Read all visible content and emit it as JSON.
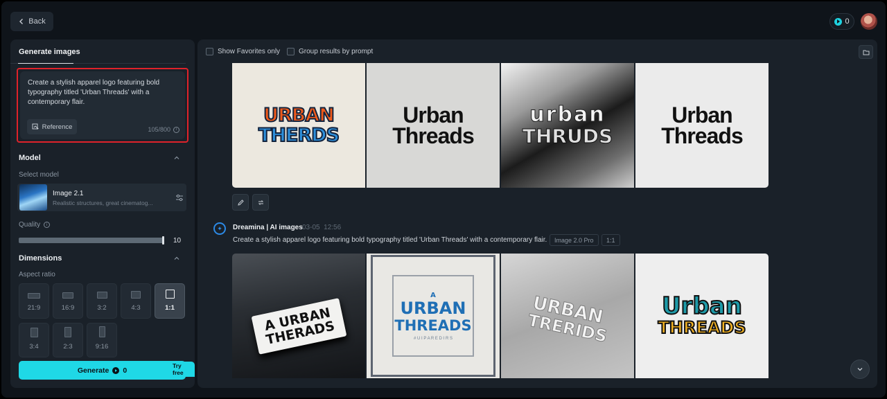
{
  "topbar": {
    "back_label": "Back",
    "credits": "0"
  },
  "left": {
    "tab": "Generate images",
    "prompt": "Create a stylish apparel logo featuring bold typography titled 'Urban Threads' with a contemporary flair.",
    "reference_label": "Reference",
    "char_count": "105/800",
    "model_heading": "Model",
    "select_model_label": "Select model",
    "model_name": "Image 2.1",
    "model_desc": "Realistic structures, great cinematog...",
    "quality_label": "Quality",
    "quality_value": "10",
    "dimensions_heading": "Dimensions",
    "aspect_ratio_label": "Aspect ratio",
    "ratios": [
      "21:9",
      "16:9",
      "3:2",
      "4:3",
      "1:1",
      "3:4",
      "2:3",
      "9:16"
    ],
    "selected_ratio": "1:1",
    "generate_label": "Generate",
    "generate_cost": "0",
    "try_free": "Try free"
  },
  "right": {
    "show_favorites": "Show Favorites only",
    "group_by_prompt": "Group results by prompt",
    "row1": [
      {
        "line1": "URBAN",
        "line2": "THERDS"
      },
      {
        "line1": "Urban",
        "line2": "Threads"
      },
      {
        "line1": "urban",
        "line2": "THRUDS"
      },
      {
        "line1": "Urban",
        "line2": "Threads"
      }
    ],
    "author": "Dreamina | AI images",
    "date": "03-05",
    "time": "12:56",
    "prompt": "Create a stylish apparel logo featuring bold typography titled 'Urban Threads' with a contemporary flair.",
    "tag_model": "Image 2.0 Pro",
    "tag_ratio": "1:1",
    "row2": [
      {
        "line1": "A URBAN",
        "line2": "THERADS",
        "sub": ""
      },
      {
        "pre": "A",
        "line1": "URBAN",
        "line2": "THREADS",
        "sub": "# U I P A R E D I R S"
      },
      {
        "line1": "URBAN",
        "line2": "TRERIDS",
        "sub": ""
      },
      {
        "line1": "Urban",
        "line2": "THREADS",
        "sub": ""
      }
    ]
  },
  "colors": {
    "accent": "#1fd8e6",
    "highlight_border": "#e0222a",
    "panel": "#1a2129",
    "background": "#0f141a"
  }
}
